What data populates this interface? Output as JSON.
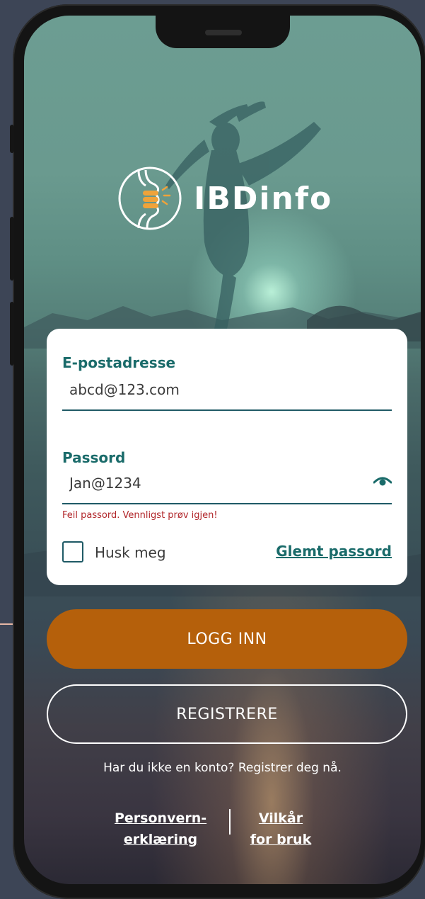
{
  "app": {
    "name": "IBDinfo"
  },
  "login_form": {
    "email_label": "E-postadresse",
    "email_value": "abcd@123.com",
    "password_label": "Passord",
    "password_value": "Jan@1234",
    "error_message": "Feil passord. Vennligst prøv igjen!",
    "remember_label": "Husk meg",
    "forgot_label": "Glemt passord"
  },
  "actions": {
    "login_label": "LOGG INN",
    "register_label": "REGISTRERE",
    "register_prompt": "Har du ikke en konto? Registrer deg nå."
  },
  "footer": {
    "privacy_line1": "Personvern-",
    "privacy_line2": "erklæring",
    "terms_line1": "Vilkår",
    "terms_line2": "for bruk"
  },
  "colors": {
    "accent_teal": "#1a6b6a",
    "button_orange": "#b5600b",
    "error_red": "#b1262a",
    "annotation_marker": "#e8b8a6"
  },
  "icons": [
    "logo-intestine-icon",
    "eye-icon"
  ]
}
